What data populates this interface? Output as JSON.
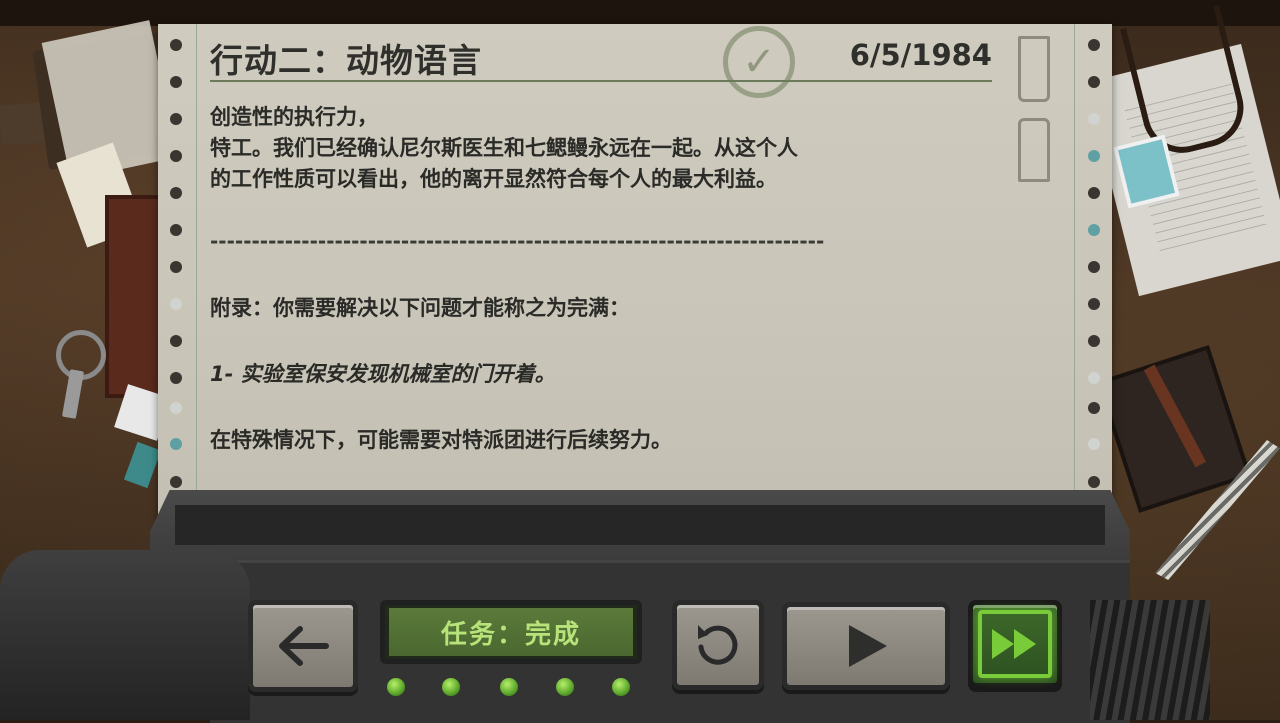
{
  "mission": {
    "title": "行动二：动物语言",
    "date": "6/5/1984",
    "stamp": "✓",
    "body_lines": [
      "创造性的执行力，",
      "特工。我们已经确认尼尔斯医生和七鳃鳗永远在一起。从这个人",
      "的工作性质可以看出，他的离开显然符合每个人的最大利益。"
    ],
    "separator": "--------------------------------------------------------------------------",
    "appendix": "附录：你需要解决以下问题才能称之为完满：",
    "item_1": "1- 实验室保安发现机械室的门开着。",
    "note": "在特殊情况下，可能需要对特派团进行后续努力。"
  },
  "controls": {
    "status_display": "任务：完成",
    "back_icon": "arrow-left",
    "reset_icon": "rotate-ccw",
    "play_icon": "play",
    "fast_forward_icon": "fast-forward",
    "progress_leds": 5,
    "accent_color": "#7acb3a"
  }
}
